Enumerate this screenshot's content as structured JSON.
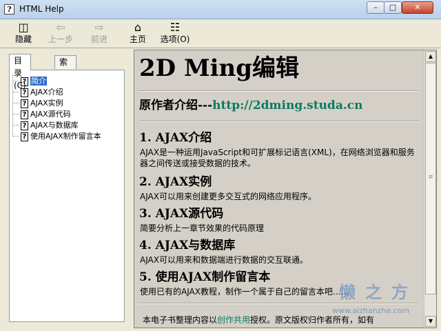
{
  "window": {
    "title": "HTML Help"
  },
  "toolbar": {
    "buttons": [
      {
        "label": "隐藏",
        "icon": "hide-icon",
        "enabled": true
      },
      {
        "label": "上一步",
        "icon": "back-arrow-icon",
        "enabled": false
      },
      {
        "label": "前进",
        "icon": "forward-arrow-icon",
        "enabled": false
      },
      {
        "label": "主页",
        "icon": "home-icon",
        "enabled": true
      },
      {
        "label": "选项(O)",
        "icon": "options-icon",
        "enabled": true
      }
    ]
  },
  "tabs": [
    {
      "label": "目录(C)",
      "active": true
    },
    {
      "label": "索引(N)",
      "active": false
    }
  ],
  "tree": {
    "items": [
      {
        "label": "简介",
        "selected": true
      },
      {
        "label": "AJAX介绍",
        "selected": false
      },
      {
        "label": "AJAX实例",
        "selected": false
      },
      {
        "label": "AJAX源代码",
        "selected": false
      },
      {
        "label": "AJAX与数据库",
        "selected": false
      },
      {
        "label": "使用AJAX制作留言本",
        "selected": false
      }
    ]
  },
  "content": {
    "title": "2D Ming编辑",
    "author_label": "原作者介绍---",
    "author_link": "http://2dming.studa.cn",
    "sections": [
      {
        "heading": "1. AJAX介绍",
        "text": "AJAX是一种运用JavaScript和可扩展标记语言(XML)，在网络浏览器和服务器之间传送或接受数据的技术。"
      },
      {
        "heading": "2. AJAX实例",
        "text": "AJAX可以用来创建更多交互式的网络应用程序。"
      },
      {
        "heading": "3. AJAX源代码",
        "text": "简要分析上一章节效果的代码原理"
      },
      {
        "heading": "4. AJAX与数据库",
        "text": "AJAX可以用来和数据端进行数据的交互联通。"
      },
      {
        "heading": "5. 使用AJAX制作留言本",
        "text": "使用已有的AJAX教程，制作一个属于自己的留言本吧……"
      }
    ],
    "footer_pre": "本电子书整理内容以",
    "footer_link": "创作共用",
    "footer_post": "授权。原文版权归作者所有，如有"
  },
  "watermark": {
    "brand": "懒之方",
    "url": "www.aizhanzhe.com"
  }
}
